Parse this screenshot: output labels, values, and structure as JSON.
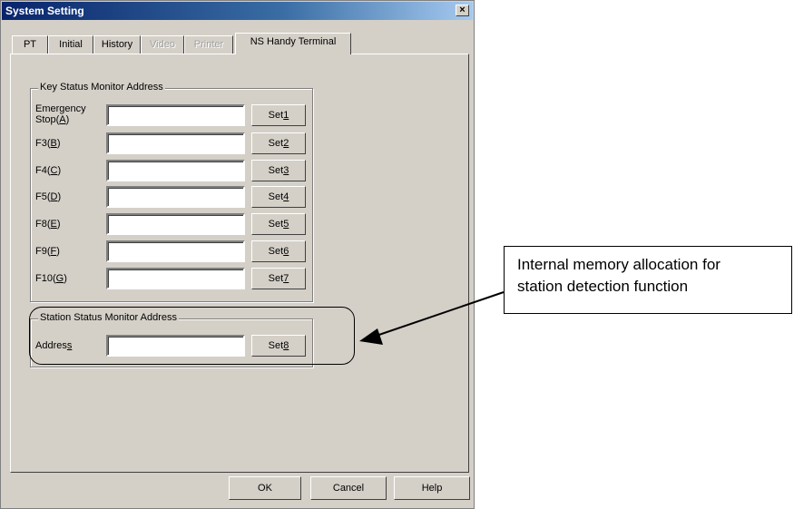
{
  "window": {
    "title": "System Setting",
    "close_glyph": "×"
  },
  "tabs": [
    {
      "label": "PT",
      "state": "normal"
    },
    {
      "label": "Initial",
      "state": "normal"
    },
    {
      "label": "History",
      "state": "normal"
    },
    {
      "label": "Video",
      "state": "disabled"
    },
    {
      "label": "Printer",
      "state": "disabled"
    },
    {
      "label": "NS Handy Terminal",
      "state": "active"
    }
  ],
  "key_status": {
    "legend": "Key Status Monitor Address",
    "rows": [
      {
        "label_line1": "Emergency",
        "label_pre": "Stop(",
        "key": "A",
        "label_post": ")",
        "value": "",
        "button_pre": "Set",
        "button_key": "1"
      },
      {
        "label_pre": "F3(",
        "key": "B",
        "label_post": ")",
        "value": "",
        "button_pre": "Set",
        "button_key": "2"
      },
      {
        "label_pre": "F4(",
        "key": "C",
        "label_post": ")",
        "value": "",
        "button_pre": "Set",
        "button_key": "3"
      },
      {
        "label_pre": "F5(",
        "key": "D",
        "label_post": ")",
        "value": "",
        "button_pre": "Set",
        "button_key": "4"
      },
      {
        "label_pre": "F8(",
        "key": "E",
        "label_post": ")",
        "value": "",
        "button_pre": "Set",
        "button_key": "5"
      },
      {
        "label_pre": "F9(",
        "key": "F",
        "label_post": ")",
        "value": "",
        "button_pre": "Set",
        "button_key": "6"
      },
      {
        "label_pre": "F10(",
        "key": "G",
        "label_post": ")",
        "value": "",
        "button_pre": "Set",
        "button_key": "7"
      }
    ]
  },
  "station_status": {
    "legend": "Station Status Monitor Address",
    "label_pre": "Addres",
    "label_key": "s",
    "value": "",
    "button_pre": "Set",
    "button_key": "8"
  },
  "buttons": {
    "ok": "OK",
    "cancel": "Cancel",
    "help": "Help"
  },
  "annotation": {
    "line1": "Internal memory allocation for",
    "line2": "station detection function"
  }
}
